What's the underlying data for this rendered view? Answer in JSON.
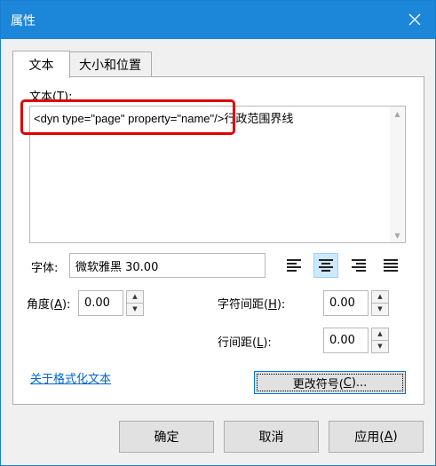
{
  "window": {
    "title": "属性",
    "close_icon": "close-icon"
  },
  "tabs": [
    {
      "label": "文本",
      "active": true
    },
    {
      "label": "大小和位置",
      "active": false
    }
  ],
  "text_section": {
    "label_prefix": "文本(",
    "label_accel": "T",
    "label_suffix": "):",
    "content_code": "<dyn type=\"page\" property=\"name\"/>",
    "content_rest": "行政范围界线"
  },
  "font": {
    "label": "字体:",
    "value": "微软雅黑 30.00"
  },
  "alignment": {
    "options": [
      "align-left",
      "align-center",
      "align-right",
      "align-justify"
    ],
    "selected": "align-center"
  },
  "angle": {
    "label_prefix": "角度(",
    "label_accel": "A",
    "label_suffix": "):",
    "value": "0.00"
  },
  "char_spacing": {
    "label_prefix": "字符间距(",
    "label_accel": "H",
    "label_suffix": "):",
    "value": "0.00"
  },
  "line_spacing": {
    "label_prefix": "行间距(",
    "label_accel": "L",
    "label_suffix": "):",
    "value": "0.00"
  },
  "link": {
    "label": "关于格式化文本"
  },
  "change_symbol": {
    "prefix": "更改符号(",
    "accel": "C",
    "suffix": ")..."
  },
  "buttons": {
    "ok": "确定",
    "cancel": "取消",
    "apply_prefix": "应用(",
    "apply_accel": "A",
    "apply_suffix": ")"
  },
  "colors": {
    "titlebar": "#1c86d8",
    "highlight_box": "#e00000",
    "link": "#0066cc"
  }
}
